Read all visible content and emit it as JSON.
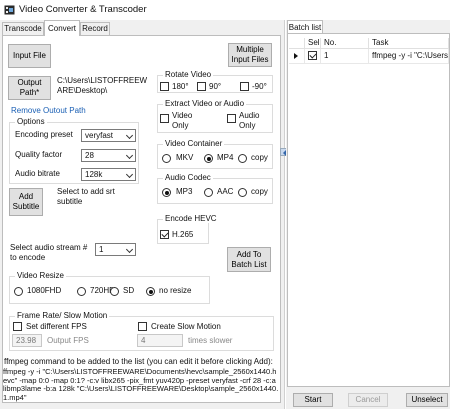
{
  "window": {
    "title": "Video Converter & Transcoder"
  },
  "tabs": [
    "Transcode",
    "Convert",
    "Record"
  ],
  "convert": {
    "input_file_btn": "Input File",
    "multiple_input_btn": "Multiple Input Files",
    "output_path_btn": "Output Path*",
    "output_path_value": "C:\\Users\\LISTOFFREEW ARE\\Desktop\\",
    "remove_output_path": "Remove Outout Path",
    "options": {
      "label": "Options",
      "encoding_preset_label": "Encoding preset",
      "encoding_preset_value": "veryfast",
      "quality_factor_label": "Quality factor",
      "quality_factor_value": "28",
      "audio_bitrate_label": "Audio bitrate",
      "audio_bitrate_value": "128k"
    },
    "add_subtitle_btn": "Add Subtitle",
    "subtitle_hint": "Select to add srt subtitle",
    "rotate": {
      "label": "Rotate Video",
      "opt1": "180°",
      "opt2": "90°",
      "opt3": "-90°"
    },
    "extract": {
      "label": "Extract Video or Audio",
      "video_only": "Video Only",
      "audio_only": "Audio Only"
    },
    "container": {
      "label": "Video Container",
      "mkv": "MKV",
      "mp4": "MP4",
      "copy": "copy"
    },
    "audio_codec": {
      "label": "Audio Codec",
      "mp3": "MP3",
      "aac": "AAC",
      "copy": "copy"
    },
    "hevc": {
      "label": "Encode HEVC",
      "h265": "H.265"
    },
    "audio_stream_label": "Select audio stream # to encode",
    "audio_stream_value": "1",
    "add_to_batch_btn": "Add To Batch List",
    "resize": {
      "label": "Video Resize",
      "r1080": "1080FHD",
      "r720": "720HD",
      "sd": "SD",
      "none": "no resize"
    },
    "fps": {
      "label": "Frame Rate/ Slow Motion",
      "set_fps": "Set different FPS",
      "slow_motion": "Create Slow Motion",
      "fps_value": "23.98",
      "fps_unit": "Output FPS",
      "slow_value": "4",
      "slow_unit": "times slower"
    },
    "cmd_label": "ffmpeg command to be added to the list (you can edit it before clicking Add):",
    "cmd_text": "ffmpeg -y -i \"C:\\Users\\LISTOFFREEWARE\\Documents\\hevc\\sample_2560x1440.hevc\" -map 0:0 -map 0:1? -c:v libx265 -pix_fmt yuv420p -preset veryfast -crf 28 -c:a libmp3lame -b:a 128k \"C:\\Users\\LISTOFFREEWARE\\Desktop\\sample_2560x1440.1.mp4\""
  },
  "batch": {
    "tab_label": "Batch list",
    "col_sel": "Sel",
    "col_no": "No.",
    "col_task": "Task",
    "rows": [
      {
        "no": "1",
        "task": "ffmpeg -y -i \"C:\\Users\\LIST"
      }
    ],
    "start_btn": "Start",
    "cancel_btn": "Cancel",
    "unselect_btn": "Unselect"
  }
}
